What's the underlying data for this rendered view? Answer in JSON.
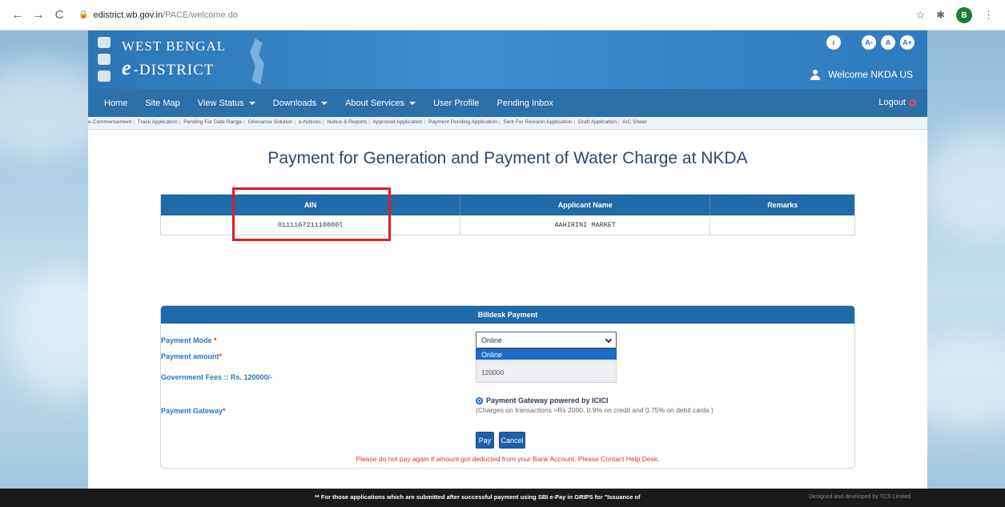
{
  "browser": {
    "url_host": "edistrict.wb.gov.in",
    "url_path": "/PACE/welcome.do",
    "profile_initial": "B"
  },
  "header": {
    "logo_line1": "WEST BENGAL",
    "logo_e": "e",
    "logo_line2": "-DISTRICT",
    "welcome": "Welcome NKDA US",
    "icon_labels": [
      "i",
      "A-",
      "A",
      "A+"
    ]
  },
  "nav": {
    "items": [
      "Home",
      "Site Map",
      "View Status",
      "Downloads",
      "About Services",
      "User Profile",
      "Pending Inbox"
    ],
    "logout": "Logout"
  },
  "sub_links": [
    "e-Commencement",
    "Track Application",
    "Pending For Date Range",
    "Grievance Solution",
    "e-Notices",
    "Notice & Reports",
    "Approved Application",
    "Payment Pending Application",
    "Sent For Revision Application",
    "Draft Application",
    "A/C Sheet"
  ],
  "page": {
    "title": "Payment for Generation and Payment of Water Charge at NKDA"
  },
  "table": {
    "headers": [
      "AIN",
      "Applicant Name",
      "Remarks"
    ],
    "row": [
      "011116721110000l",
      "AAHIRINI MARKET",
      ""
    ]
  },
  "payment": {
    "heading": "Billdesk Payment",
    "mode_label": "Payment Mode",
    "amount_label": "Payment amount",
    "fees_label": "Government Fees :: Rs. 120000/-",
    "gateway_label": "Payment Gateway",
    "mode_selected": "Online",
    "dropdown_option": "Online",
    "amount_value": "120000",
    "gateway_option": "Payment Gateway powered by ICICI",
    "gateway_note": "(Charges on transactions >Rs 2000, 0.9% on credit and 0.75% on debit cards )",
    "pay_button": "Pay",
    "cancel_button": "Cancel",
    "warning": "Please do not pay again if amount got deducted from your Bank Account. Please Contact Help Desk."
  },
  "footer": {
    "message": "** For those applications which are submitted after successful payment using SBI e-Pay in GRIPS for \"Issuance of",
    "credit": "Designed and developed by TCS Limited"
  }
}
